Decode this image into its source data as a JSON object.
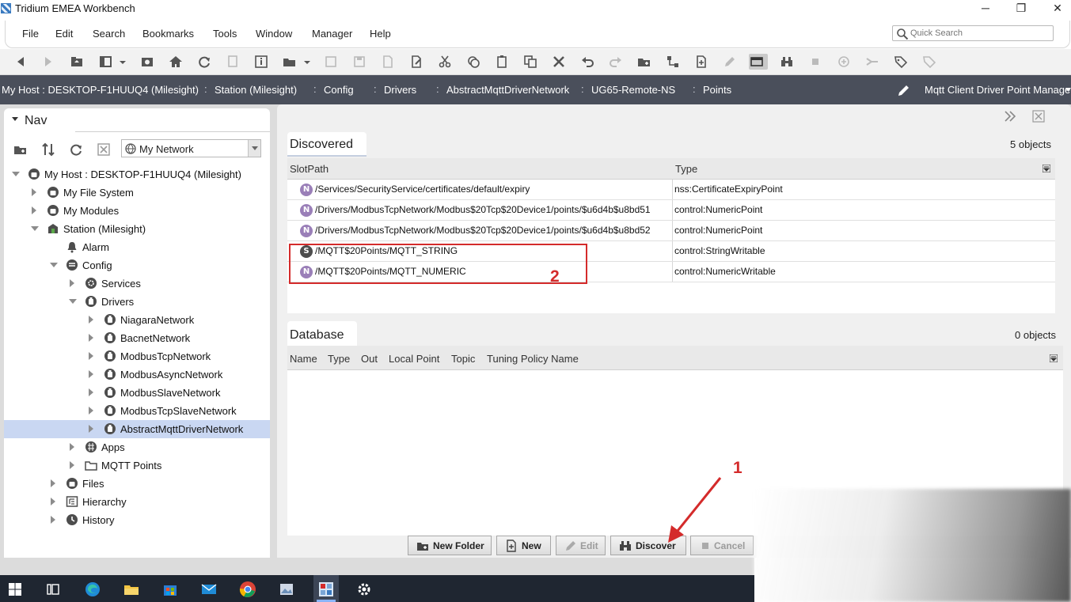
{
  "window": {
    "title": "Tridium EMEA Workbench",
    "minimize": "─",
    "maximize": "❐",
    "close": "✕"
  },
  "menu": {
    "items": [
      "File",
      "Edit",
      "Search",
      "Bookmarks",
      "Tools",
      "Window",
      "Manager",
      "Help"
    ]
  },
  "search": {
    "placeholder": "Quick Search"
  },
  "path": {
    "crumbs": [
      "My Host : DESKTOP-F1HUUQ4 (Milesight)",
      "Station (Milesight)",
      "Config",
      "Drivers",
      "AbstractMqttDriverNetwork",
      "UG65-Remote-NS",
      "Points"
    ],
    "separator": ":",
    "view": "Mqtt Client Driver Point Manager"
  },
  "nav": {
    "tab_label": "Nav",
    "network_select": "My Network",
    "tree": [
      {
        "label": "My Host : DESKTOP-F1HUUQ4 (Milesight)",
        "icon": "host-icon",
        "state": "open"
      },
      {
        "label": "My File System",
        "icon": "filesystem-icon",
        "state": "closed"
      },
      {
        "label": "My Modules",
        "icon": "modules-icon",
        "state": "closed"
      },
      {
        "label": "Station (Milesight)",
        "icon": "station-icon",
        "state": "open"
      },
      {
        "label": "Alarm",
        "icon": "bell-icon",
        "state": "none"
      },
      {
        "label": "Config",
        "icon": "database-icon",
        "state": "open"
      },
      {
        "label": "Services",
        "icon": "gear-icon",
        "state": "closed"
      },
      {
        "label": "Drivers",
        "icon": "driver-icon",
        "state": "open"
      },
      {
        "label": "NiagaraNetwork",
        "icon": "driver-icon",
        "state": "closed"
      },
      {
        "label": "BacnetNetwork",
        "icon": "driver-icon",
        "state": "closed"
      },
      {
        "label": "ModbusTcpNetwork",
        "icon": "driver-icon",
        "state": "closed"
      },
      {
        "label": "ModbusAsyncNetwork",
        "icon": "driver-icon",
        "state": "closed"
      },
      {
        "label": "ModbusSlaveNetwork",
        "icon": "driver-icon",
        "state": "closed"
      },
      {
        "label": "ModbusTcpSlaveNetwork",
        "icon": "driver-icon",
        "state": "closed"
      },
      {
        "label": "AbstractMqttDriverNetwork",
        "icon": "driver-icon",
        "state": "closed"
      },
      {
        "label": "Apps",
        "icon": "apps-icon",
        "state": "closed"
      },
      {
        "label": "MQTT Points",
        "icon": "folder-icon",
        "state": "closed"
      },
      {
        "label": "Files",
        "icon": "files-icon",
        "state": "closed"
      },
      {
        "label": "Hierarchy",
        "icon": "hierarchy-icon",
        "state": "closed"
      },
      {
        "label": "History",
        "icon": "history-icon",
        "state": "closed"
      }
    ]
  },
  "discovered": {
    "title": "Discovered",
    "count": "5 objects",
    "columns": [
      "SlotPath",
      "Type"
    ],
    "rows": [
      {
        "badge": "N",
        "slot": "/Services/SecurityService/certificates/default/expiry",
        "type": "nss:CertificateExpiryPoint"
      },
      {
        "badge": "N",
        "slot": "/Drivers/ModbusTcpNetwork/Modbus$20Tcp$20Device1/points/$u6d4b$u8bd51",
        "type": "control:NumericPoint"
      },
      {
        "badge": "N",
        "slot": "/Drivers/ModbusTcpNetwork/Modbus$20Tcp$20Device1/points/$u6d4b$u8bd52",
        "type": "control:NumericPoint"
      },
      {
        "badge": "S",
        "slot": "/MQTT$20Points/MQTT_STRING",
        "type": "control:StringWritable"
      },
      {
        "badge": "N",
        "slot": "/MQTT$20Points/MQTT_NUMERIC",
        "type": "control:NumericWritable"
      }
    ]
  },
  "database": {
    "title": "Database",
    "count": "0 objects",
    "columns": [
      "Name",
      "Type",
      "Out",
      "Local Point",
      "Topic",
      "Tuning Policy Name"
    ]
  },
  "buttons": {
    "new_folder": "New Folder",
    "new": "New",
    "edit": "Edit",
    "discover": "Discover",
    "cancel": "Cancel"
  },
  "annotations": {
    "one": "1",
    "two": "2"
  },
  "colors": {
    "path_bg": "#4a4f5b",
    "selection": "#c9d7f2",
    "annotation": "#d42b2b",
    "badge_numeric": "#9a7fb8"
  }
}
